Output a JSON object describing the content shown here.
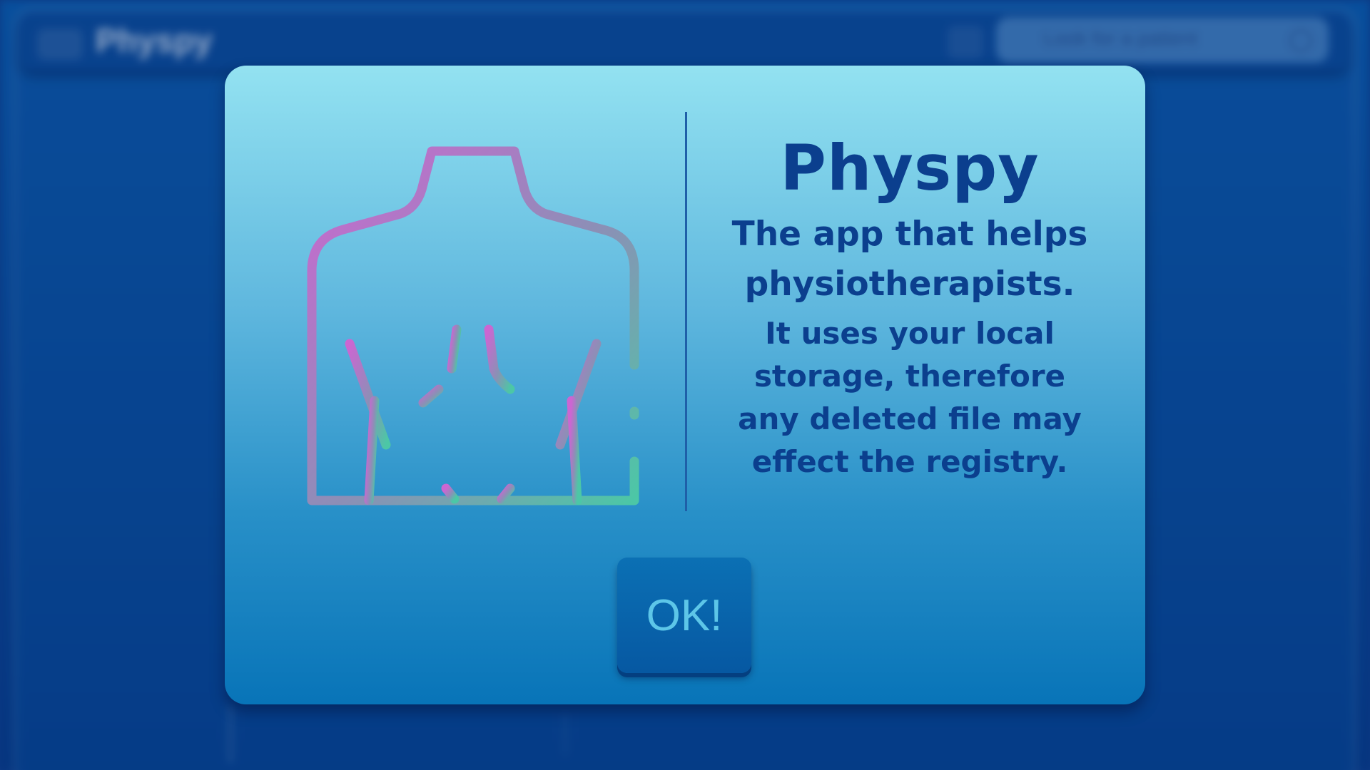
{
  "background_app": {
    "title": "Physpy",
    "search": {
      "placeholder": "Look for a patient"
    }
  },
  "modal": {
    "title": "Physpy",
    "tagline_lines": [
      "The app that helps",
      "physiotherapists."
    ],
    "note_lines": [
      "It uses your local",
      "storage, therefore",
      "any deleted file may",
      "effect the registry."
    ],
    "ok_label": "OK!"
  },
  "colors": {
    "modal_top": "#93e2f1",
    "modal_bottom": "#0874b8",
    "text": "#0b3f8e",
    "button": "#0658a2",
    "button_text": "#5dc6e8",
    "icon_gradient": [
      "#c569d0",
      "#8a90b8",
      "#4fc3a8"
    ]
  },
  "icons": {
    "illustration": "human-back-outline-icon"
  }
}
